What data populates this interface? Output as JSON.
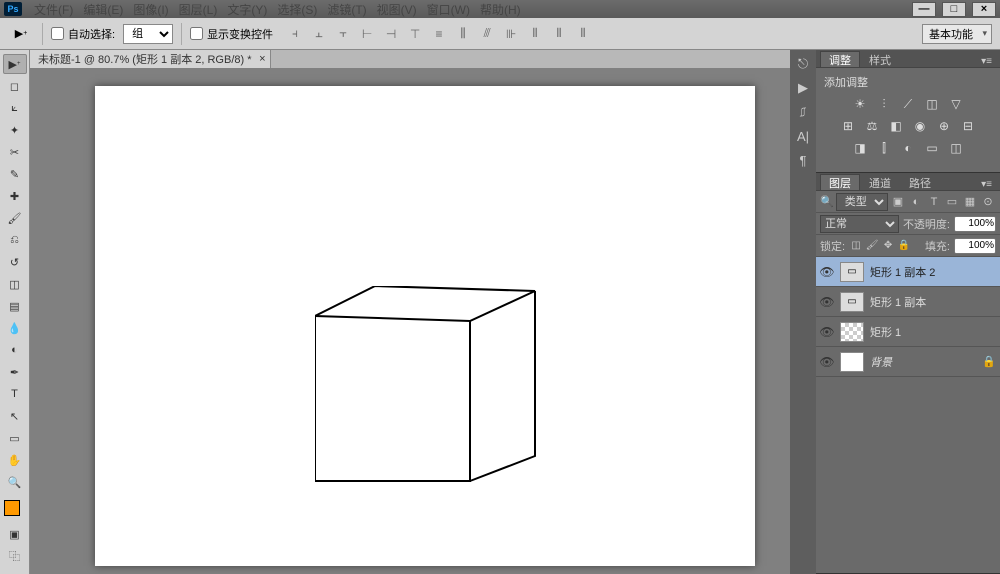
{
  "app": {
    "logo": "Ps"
  },
  "menu": {
    "items": [
      "文件(F)",
      "编辑(E)",
      "图像(I)",
      "图层(L)",
      "文字(Y)",
      "选择(S)",
      "滤镜(T)",
      "视图(V)",
      "窗口(W)",
      "帮助(H)"
    ]
  },
  "window_controls": {
    "min": "—",
    "max": "□",
    "close": "×"
  },
  "options": {
    "auto_select": "自动选择:",
    "group": "组",
    "show_transform": "显示变换控件",
    "workspace": "基本功能"
  },
  "document": {
    "tab_title": "未标题-1 @ 80.7% (矩形 1 副本 2, RGB/8) *"
  },
  "panels": {
    "adjustments": {
      "tab1": "调整",
      "tab2": "样式",
      "title": "添加调整"
    },
    "layers": {
      "tab1": "图层",
      "tab2": "通道",
      "tab3": "路径",
      "filter": "类型",
      "blend": "正常",
      "opacity_label": "不透明度:",
      "opacity_value": "100%",
      "lock_label": "锁定:",
      "fill_label": "填充:",
      "fill_value": "100%",
      "items": [
        {
          "name": "矩形 1 副本 2",
          "selected": true,
          "type": "vector"
        },
        {
          "name": "矩形 1 副本",
          "selected": false,
          "type": "vector"
        },
        {
          "name": "矩形 1",
          "selected": false,
          "type": "bitmap"
        },
        {
          "name": "背景",
          "selected": false,
          "type": "bg",
          "locked": true
        }
      ]
    }
  }
}
